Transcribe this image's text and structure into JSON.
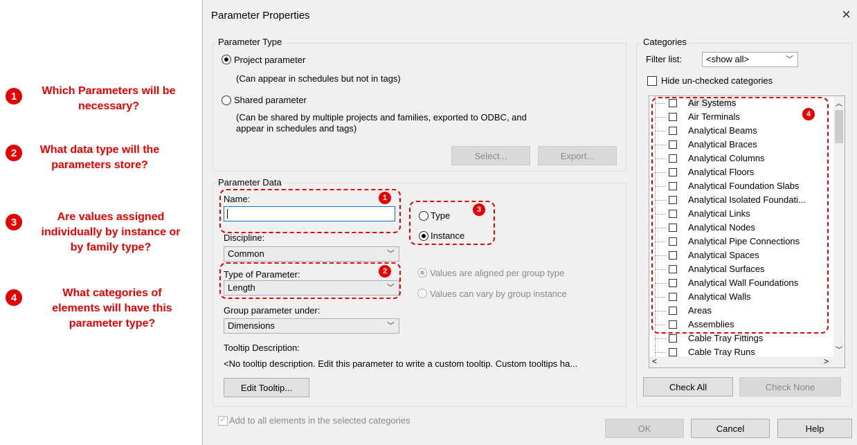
{
  "annotations": [
    {
      "num": "1",
      "text": "Which Parameters will be necessary?"
    },
    {
      "num": "2",
      "text": "What data type will the parameters store?"
    },
    {
      "num": "3",
      "text": "Are values assigned individually by instance or by family type?"
    },
    {
      "num": "4",
      "text": "What categories of elements will have this parameter type?"
    }
  ],
  "dialog": {
    "title": "Parameter Properties",
    "close": "×"
  },
  "param_type": {
    "legend": "Parameter Type",
    "project_label": "Project parameter",
    "project_desc": "(Can appear in schedules but not in tags)",
    "shared_label": "Shared parameter",
    "shared_desc1": "(Can be shared by multiple projects and families, exported to ODBC, and",
    "shared_desc2": "appear in schedules and tags)",
    "select_btn": "Select...",
    "export_btn": "Export..."
  },
  "param_data": {
    "legend": "Parameter Data",
    "name_label": "Name:",
    "name_value": "",
    "discipline_label": "Discipline:",
    "discipline_value": "Common",
    "type_label": "Type of Parameter:",
    "type_value": "Length",
    "group_label": "Group parameter under:",
    "group_value": "Dimensions",
    "tooltip_label": "Tooltip Description:",
    "tooltip_text": "<No tooltip description. Edit this parameter to write a custom tooltip. Custom tooltips ha...",
    "edit_tooltip_btn": "Edit Tooltip...",
    "type_radio": "Type",
    "instance_radio": "Instance",
    "aligned_radio": "Values are aligned per group type",
    "vary_radio": "Values can vary by group instance"
  },
  "callouts": {
    "one": "1",
    "two": "2",
    "three": "3",
    "four": "4"
  },
  "categories": {
    "legend": "Categories",
    "filter_label": "Filter list:",
    "filter_value": "<show all>",
    "hide_label": "Hide un-checked categories",
    "items": [
      "Air Systems",
      "Air Terminals",
      "Analytical Beams",
      "Analytical Braces",
      "Analytical Columns",
      "Analytical Floors",
      "Analytical Foundation Slabs",
      "Analytical Isolated Foundati...",
      "Analytical Links",
      "Analytical Nodes",
      "Analytical Pipe Connections",
      "Analytical Spaces",
      "Analytical Surfaces",
      "Analytical Wall Foundations",
      "Analytical Walls",
      "Areas",
      "Assemblies",
      "Cable Tray Fittings",
      "Cable Tray Runs"
    ],
    "check_all": "Check All",
    "check_none": "Check None"
  },
  "footer": {
    "add_all_label": "Add to all elements in the selected categories",
    "ok": "OK",
    "cancel": "Cancel",
    "help": "Help"
  }
}
